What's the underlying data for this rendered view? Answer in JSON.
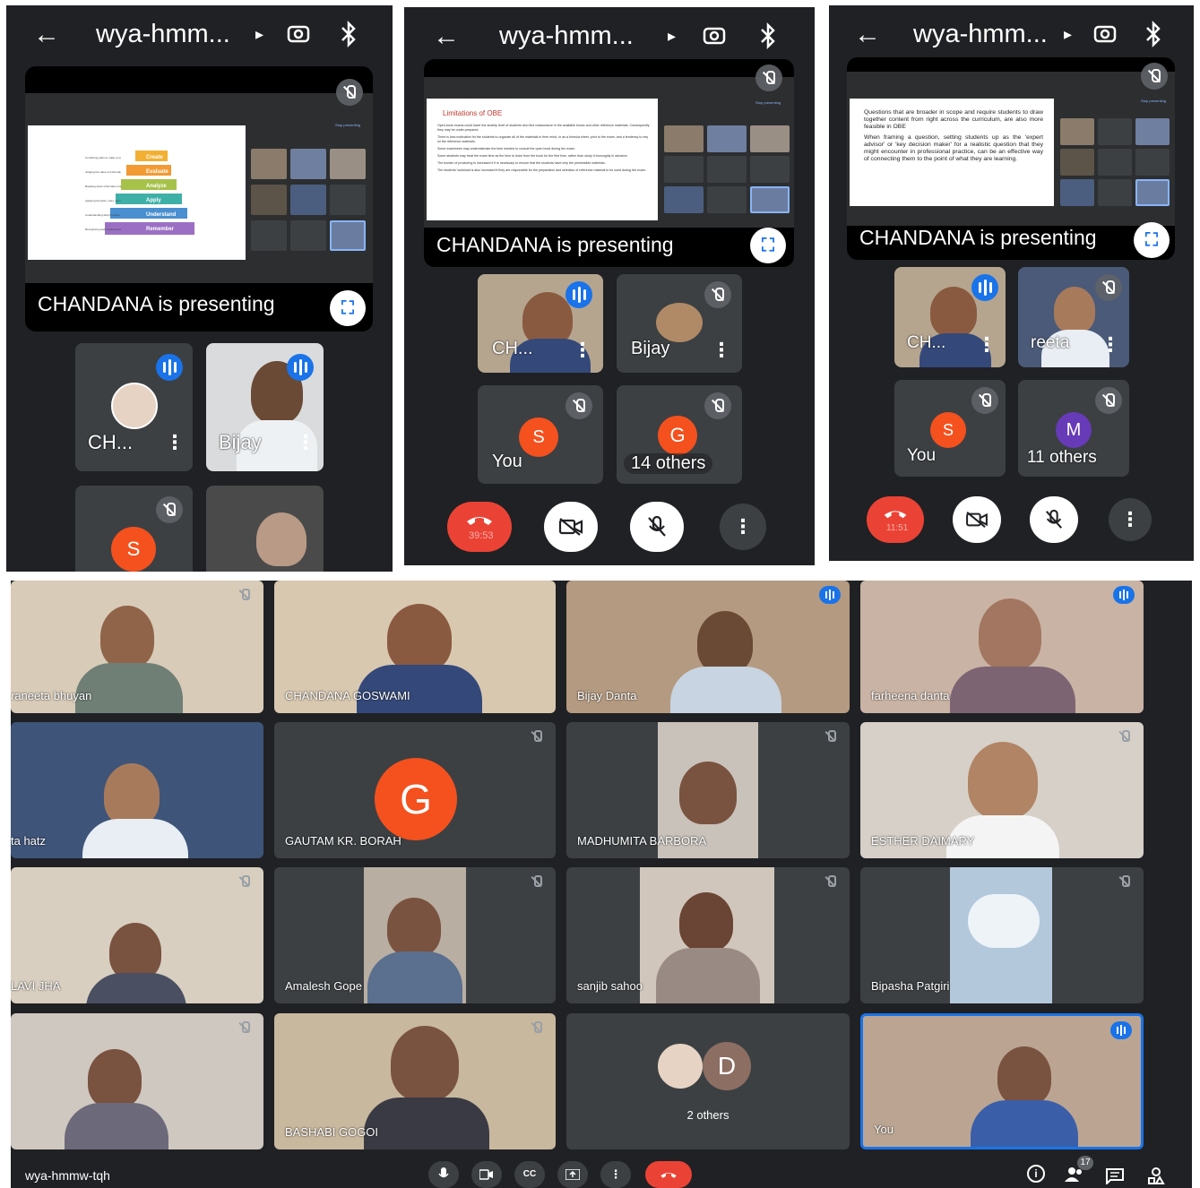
{
  "phone1": {
    "meeting_code": "wya-hmm...",
    "presenter_label": "CHANDANA is presenting",
    "slide_levels": [
      "Create",
      "Evaluate",
      "Analyze",
      "Apply",
      "Understand",
      "Remember"
    ],
    "slide_rows": [
      "Combining parts to make a new whole",
      "Judging the value of information or ideas",
      "Breaking down information into component parts",
      "Applying the facts, rules, concepts, and ideas",
      "Understanding what the facts mean",
      "Recognizing and recalling facts"
    ],
    "stop_label": "Stop presenting",
    "tiles": [
      {
        "name": "CH...",
        "avatar": ""
      },
      {
        "name": "Bijay",
        "avatar": ""
      },
      {
        "name": "",
        "avatar": "S"
      },
      {
        "name": "",
        "avatar": ""
      }
    ]
  },
  "phone2": {
    "meeting_code": "wya-hmm...",
    "presenter_label": "CHANDANA is presenting",
    "slide_title": "Limitations of OBE",
    "slide_bullets": [
      "Open-book exams could lower the anxiety level of students who find reassurance in the available books and other reference materials. Consequently they may be under-prepared.",
      "There is less motivation for the students to organize all of the materials in their mind, or as a formula sheet, prior to the exam, and a tendency to rely on the reference materials.",
      "Some examinees may underestimate the time needed to consult the open book during the exam.",
      "Some students may treat the exam time as the time to learn from the book for the first time, rather than study it thoroughly in advance.",
      "The burden of proctoring is increased if it is necessary to ensure that the students have only the permissible materials.",
      "The students' workload is also increased if they are responsible for the preparation and selection of reference material to be used during the exam."
    ],
    "stop_label": "Stop presenting",
    "tiles": [
      {
        "name": "CH...",
        "avatar": ""
      },
      {
        "name": "Bijay",
        "avatar": ""
      },
      {
        "name": "You",
        "avatar": "S"
      },
      {
        "name": "14 others",
        "avatar": "G"
      }
    ],
    "timer": "39:53"
  },
  "phone3": {
    "meeting_code": "wya-hmm...",
    "presenter_label": "CHANDANA is presenting",
    "slide_bullets": [
      "Questions that are broader in scope and require students to draw together content from right across the curriculum, are also more feasible in OBE",
      "When framing a question, setting students up as the 'expert advisor' or 'key decision maker' for a realistic question that they might encounter in professional practice, can be an effective way of connecting them to the point of what they are learning."
    ],
    "stop_label": "Stop presenting",
    "tiles": [
      {
        "name": "CH...",
        "avatar": ""
      },
      {
        "name": "reeta",
        "avatar": ""
      },
      {
        "name": "You",
        "avatar": "S"
      },
      {
        "name": "11 others",
        "avatar": "M"
      }
    ],
    "timer": "11:51"
  },
  "desktop": {
    "meeting_code": "wya-hmmw-tqh",
    "people_count": "17",
    "tiles": [
      {
        "name": "raneeta bhuyan"
      },
      {
        "name": "CHANDANA GOSWAMI"
      },
      {
        "name": "Bijay Danta"
      },
      {
        "name": "farheena danta"
      },
      {
        "name": "ta hatz"
      },
      {
        "name": "GAUTAM KR. BORAH",
        "avatar": "G"
      },
      {
        "name": "MADHUMITA BARBORA"
      },
      {
        "name": "ESTHER DAIMARY"
      },
      {
        "name": "LAVI JHA"
      },
      {
        "name": "Amalesh Gope"
      },
      {
        "name": "sanjib sahoo"
      },
      {
        "name": "Bipasha Patgiri"
      },
      {
        "name": ""
      },
      {
        "name": "BASHABI GOGOI"
      },
      {
        "name": "2 others",
        "avatar": "D"
      },
      {
        "name": "You"
      }
    ],
    "controls": [
      "CC"
    ]
  },
  "colors": {
    "bg": "#202124",
    "tile": "#3c4043",
    "accent": "#1a73e8",
    "end": "#ea4335",
    "orange": "#f4511e",
    "purple": "#673ab7"
  }
}
